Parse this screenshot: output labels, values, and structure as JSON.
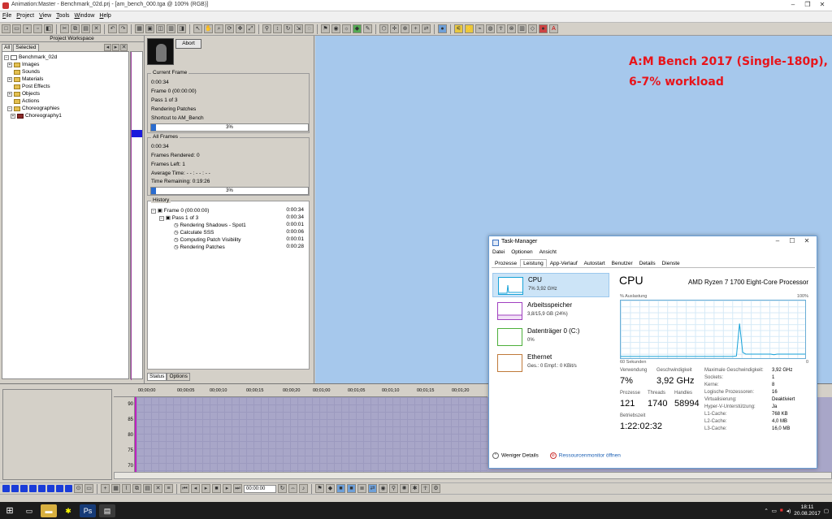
{
  "window": {
    "title": "Animation:Master - Benchmark_02d.prj - [am_bench_000.tga @ 100% (RGB)]"
  },
  "menu": [
    "File",
    "Project",
    "View",
    "Tools",
    "Window",
    "Help"
  ],
  "annotation": {
    "line1": "A:M Bench 2017 (Single-180p),",
    "line2": "6-7% workload",
    "color": "#e8141a"
  },
  "workspace": {
    "title": "Project Workspace",
    "tabs": [
      "All",
      "Selected"
    ],
    "tree": [
      {
        "label": "Benchmark_02d",
        "level": 0,
        "toggle": "-"
      },
      {
        "label": "Images",
        "level": 1,
        "toggle": "+"
      },
      {
        "label": "Sounds",
        "level": 1,
        "toggle": ""
      },
      {
        "label": "Materials",
        "level": 1,
        "toggle": "+"
      },
      {
        "label": "Post Effects",
        "level": 1,
        "toggle": ""
      },
      {
        "label": "Objects",
        "level": 1,
        "toggle": "+"
      },
      {
        "label": "Actions",
        "level": 1,
        "toggle": ""
      },
      {
        "label": "Choreographies",
        "level": 1,
        "toggle": "-"
      },
      {
        "label": "Choreography1",
        "level": 2,
        "toggle": "+"
      }
    ]
  },
  "render": {
    "abort": "Abort",
    "current": {
      "label": "Current Frame",
      "time": "0:00:34",
      "frame": "Frame 0 (00:00:00)",
      "pass": "Pass 1 of 3",
      "task": "Rendering Patches",
      "shortcut": "Shortcut to AM_Bench",
      "progress_text": "3%",
      "progress": 3
    },
    "all": {
      "label": "All Frames",
      "time": "0:00:34",
      "rendered": "Frames Rendered: 0",
      "left": "Frames Left: 1",
      "avg": "Average Time: - - : - - : - -",
      "remaining": "Time Remaining:  0:19:26",
      "progress_text": "3%",
      "progress": 3
    },
    "history": {
      "label": "History",
      "rows": [
        {
          "label": "Frame 0 (00:00:00)",
          "time": "0:00:34"
        },
        {
          "label": "Pass 1 of 3",
          "time": "0:00:34"
        },
        {
          "label": "Rendering Shadows - Spot1",
          "time": "0:00:01"
        },
        {
          "label": "Calculate SSS",
          "time": "0:00:06"
        },
        {
          "label": "Computing Patch Visibility",
          "time": "0:00:01"
        },
        {
          "label": "Rendering Patches",
          "time": "0:00:28"
        }
      ]
    },
    "tabs": [
      "Status",
      "Options"
    ]
  },
  "timeline": {
    "ticks": [
      "00;00;00",
      "00;00;05",
      "00;00;10",
      "00;00;15",
      "00;00;20",
      "00;01;00",
      "00;01;05",
      "00;01;10",
      "00;01;15",
      "00;01;20"
    ],
    "y": [
      "90",
      "85",
      "80",
      "75",
      "70"
    ],
    "frame_box": "00:00:00"
  },
  "taskmanager": {
    "title": "Task-Manager",
    "menu": [
      "Datei",
      "Optionen",
      "Ansicht"
    ],
    "tabs": [
      "Prozesse",
      "Leistung",
      "App-Verlauf",
      "Autostart",
      "Benutzer",
      "Details",
      "Dienste"
    ],
    "resources": [
      {
        "name": "CPU",
        "sub": "7% 3,92 GHz",
        "color": "#17a2d8"
      },
      {
        "name": "Arbeitsspeicher",
        "sub": "3,8/15,9 GB (24%)",
        "color": "#a040c0"
      },
      {
        "name": "Datenträger 0 (C:)",
        "sub": "0%",
        "color": "#4caf3a"
      },
      {
        "name": "Ethernet",
        "sub": "Ges.: 0 Empf.: 0 KBit/s",
        "color": "#c07a3a"
      }
    ],
    "main": {
      "title": "CPU",
      "processor": "AMD Ryzen 7 1700 Eight-Core Processor",
      "axis_top": "% Auslastung",
      "axis_max": "100%",
      "axis_bottom": "60 Sekunden",
      "axis_min": "0",
      "utilization_series": [
        3,
        3,
        3,
        3,
        3,
        3,
        3,
        3,
        3,
        3,
        3,
        3,
        3,
        3,
        3,
        3,
        3,
        3,
        3,
        3,
        3,
        3,
        3,
        3,
        3,
        3,
        3,
        3,
        3,
        3,
        3,
        3,
        3,
        3,
        3,
        3,
        3,
        4,
        60,
        10,
        7,
        7,
        7,
        7,
        7,
        7,
        7,
        7,
        7,
        6,
        7,
        7,
        7,
        7,
        7,
        7,
        7,
        7,
        7,
        7
      ],
      "stats": [
        {
          "label": "Verwendung",
          "value": "7%"
        },
        {
          "label": "Geschwindigkeit",
          "value": "3,92 GHz"
        },
        {
          "label": "Prozesse",
          "value": "121"
        },
        {
          "label": "Threads",
          "value": "1740"
        },
        {
          "label": "Handles",
          "value": "58994"
        },
        {
          "label": "Betriebszeit",
          "value": "1:22:02:32"
        }
      ],
      "kv": [
        {
          "k": "Maximale Geschwindigkeit:",
          "v": "3,92 GHz"
        },
        {
          "k": "Sockets:",
          "v": "1"
        },
        {
          "k": "Kerne:",
          "v": "8"
        },
        {
          "k": "Logische Prozessoren:",
          "v": "16"
        },
        {
          "k": "Virtualisierung:",
          "v": "Deaktiviert"
        },
        {
          "k": "Hyper-V-Unterstützung:",
          "v": "Ja"
        },
        {
          "k": "L1-Cache:",
          "v": "768 KB"
        },
        {
          "k": "L2-Cache:",
          "v": "4,0 MB"
        },
        {
          "k": "L3-Cache:",
          "v": "16,0 MB"
        }
      ]
    },
    "footer": {
      "less": "Weniger Details",
      "monitor": "Ressourcenmonitor öffnen"
    }
  },
  "taskbar": {
    "time": "18:11",
    "date": "20.08.2017"
  }
}
